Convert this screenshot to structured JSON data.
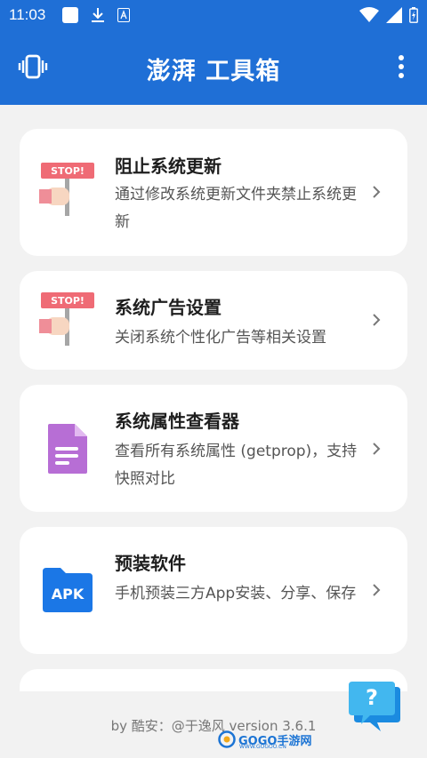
{
  "status_bar": {
    "time": "11:03"
  },
  "app_bar": {
    "title": "澎湃 工具箱"
  },
  "cards": [
    {
      "title": "阻止系统更新",
      "description": "通过修改系统更新文件夹禁止系统更新",
      "icon": "stop-sign-icon"
    },
    {
      "title": "系统广告设置",
      "description": "关闭系统个性化广告等相关设置",
      "icon": "stop-sign-icon"
    },
    {
      "title": "系统属性查看器",
      "description": "查看所有系统属性 (getprop)，支持快照对比",
      "icon": "document-icon"
    },
    {
      "title": "预装软件",
      "description": "手机预装三方App安装、分享、保存",
      "icon": "apk-folder-icon",
      "badge": "APK"
    }
  ],
  "footer": {
    "credit": "by 酷安：@于逸风 version 3.6.1"
  },
  "help": {
    "label": "?"
  },
  "watermark": {
    "brand": "GOGO手游网",
    "url": "WWW.GOGOO.CN"
  },
  "colors": {
    "primary": "#1f6fd6",
    "background": "#f2f2f2",
    "card": "#ffffff"
  }
}
